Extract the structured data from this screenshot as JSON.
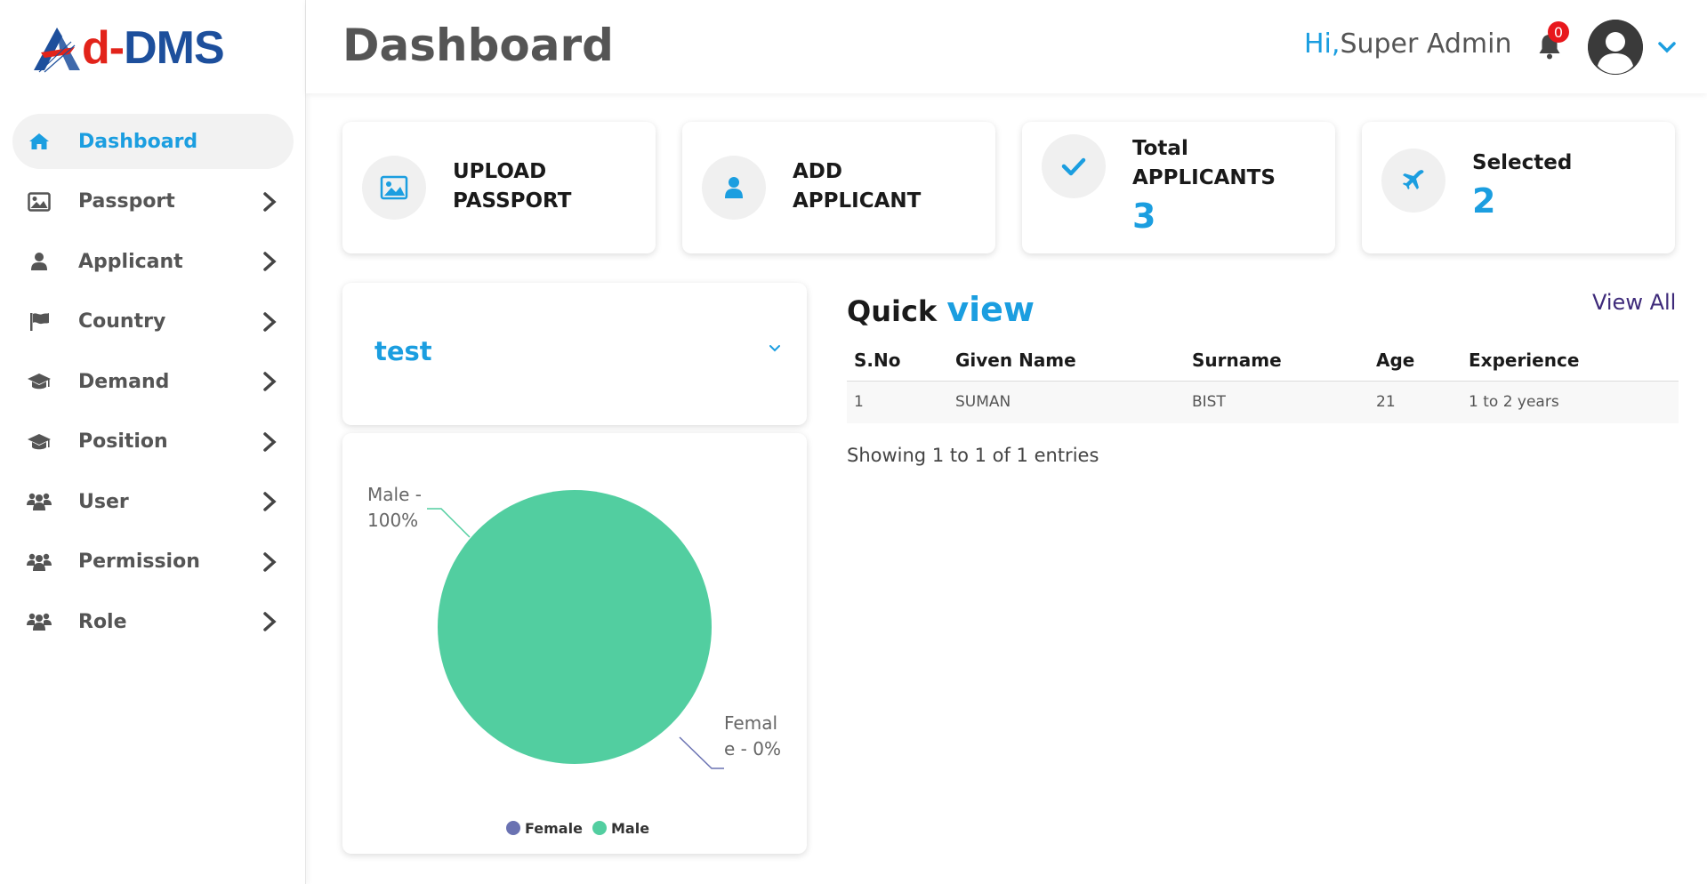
{
  "app": {
    "logo_d": "d-",
    "logo_rest": "DMS"
  },
  "sidebar": {
    "items": [
      {
        "label": "Dashboard",
        "icon": "home-icon",
        "active": true
      },
      {
        "label": "Passport",
        "icon": "image-icon"
      },
      {
        "label": "Applicant",
        "icon": "user-icon"
      },
      {
        "label": "Country",
        "icon": "flag-icon"
      },
      {
        "label": "Demand",
        "icon": "graduation-cap-icon"
      },
      {
        "label": "Position",
        "icon": "graduation-cap-icon"
      },
      {
        "label": "User",
        "icon": "users-icon"
      },
      {
        "label": "Permission",
        "icon": "users-icon"
      },
      {
        "label": "Role",
        "icon": "users-icon"
      }
    ]
  },
  "header": {
    "title": "Dashboard",
    "greeting_hi": "Hi,",
    "greeting_name": "Super Admin",
    "notification_count": "0"
  },
  "stats": [
    {
      "line1": "UPLOAD",
      "line2": "PASSPORT",
      "icon": "image-icon"
    },
    {
      "line1": "ADD",
      "line2": "APPLICANT",
      "icon": "user-icon"
    },
    {
      "line1": "Total",
      "line2": "APPLICANTS",
      "value": "3",
      "icon": "check-icon"
    },
    {
      "line1": "Selected",
      "value": "2",
      "icon": "plane-icon"
    }
  ],
  "selector": {
    "value": "test"
  },
  "chart_data": {
    "type": "pie",
    "categories": [
      "Female",
      "Male"
    ],
    "values": [
      0,
      100
    ],
    "colors": [
      "#6a72b2",
      "#52cea0"
    ],
    "data_labels": [
      "Female - 0%",
      "Male - 100%"
    ],
    "legend": [
      "Female",
      "Male"
    ],
    "legend_position": "bottom"
  },
  "quick_view": {
    "title": "Quick",
    "title_accent": "view",
    "view_all": "View All",
    "columns": [
      "S.No",
      "Given Name",
      "Surname",
      "Age",
      "Experience"
    ],
    "rows": [
      [
        "1",
        "SUMAN",
        "BIST",
        "21",
        "1 to 2 years"
      ]
    ],
    "info": "Showing 1 to 1 of 1 entries"
  },
  "colors": {
    "accent": "#1b9ee0",
    "logo_red": "#e2231a",
    "logo_blue": "#1d4f9c",
    "badge": "#e8171c"
  }
}
